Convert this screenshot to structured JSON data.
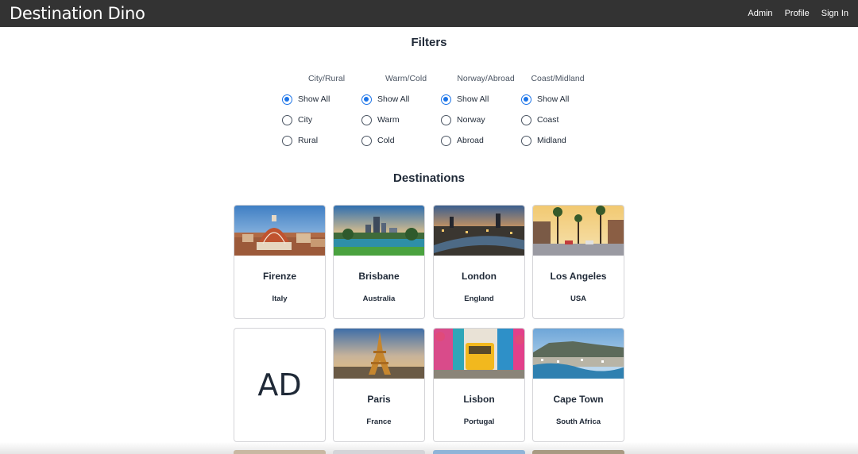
{
  "app": {
    "brand": "Destination Dino",
    "nav": [
      "Admin",
      "Profile",
      "Sign In"
    ]
  },
  "filters": {
    "title": "Filters",
    "groups": [
      {
        "label": "City/Rural",
        "options": [
          "Show All",
          "City",
          "Rural"
        ],
        "selected": "Show All"
      },
      {
        "label": "Warm/Cold",
        "options": [
          "Show All",
          "Warm",
          "Cold"
        ],
        "selected": "Show All"
      },
      {
        "label": "Norway/Abroad",
        "options": [
          "Show All",
          "Norway",
          "Abroad"
        ],
        "selected": "Show All"
      },
      {
        "label": "Coast/Midland",
        "options": [
          "Show All",
          "Coast",
          "Midland"
        ],
        "selected": "Show All"
      }
    ]
  },
  "destinations": {
    "title": "Destinations",
    "cards": [
      {
        "city": "Firenze",
        "country": "Italy",
        "image": "florence-dome-photo"
      },
      {
        "city": "Brisbane",
        "country": "Australia",
        "image": "brisbane-river-photo"
      },
      {
        "city": "London",
        "country": "England",
        "image": "london-skyline-photo"
      },
      {
        "city": "Los Angeles",
        "country": "USA",
        "image": "la-palm-street-photo"
      },
      {
        "ad": "AD"
      },
      {
        "city": "Paris",
        "country": "France",
        "image": "eiffel-tower-photo"
      },
      {
        "city": "Lisbon",
        "country": "Portugal",
        "image": "lisbon-tram-photo"
      },
      {
        "city": "Cape Town",
        "country": "South Africa",
        "image": "cape-town-aerial-photo"
      }
    ]
  },
  "colors": {
    "navbar": "#333333",
    "radio_accent": "#1a73e8"
  }
}
